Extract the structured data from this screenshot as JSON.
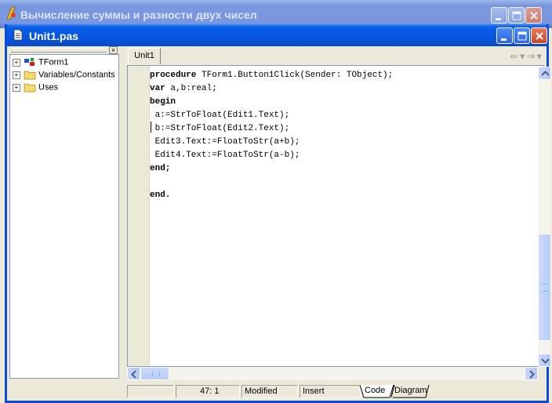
{
  "app": {
    "title": "Вычисление суммы и разности двух чисел"
  },
  "editor_window": {
    "title": "Unit1.pas",
    "tab": "Unit1"
  },
  "code_explorer": {
    "items": [
      {
        "label": "TForm1",
        "icon": "class-icon"
      },
      {
        "label": "Variables/Constants",
        "icon": "folder-icon"
      },
      {
        "label": "Uses",
        "icon": "folder-icon"
      }
    ],
    "close_glyph": "×"
  },
  "code": {
    "lines": [
      {
        "kw": "procedure",
        "rest": " TForm1.Button1Click(Sender: TObject);"
      },
      {
        "kw": "var",
        "rest": " a,b:real;"
      },
      {
        "kw": "begin",
        "rest": ""
      },
      {
        "kw": "",
        "rest": " a:=StrToFloat(Edit1.Text);"
      },
      {
        "kw": "",
        "rest": " b:=StrToFloat(Edit2.Text);"
      },
      {
        "kw": "",
        "rest": " Edit3.Text:=FloatToStr(a+b);"
      },
      {
        "kw": "",
        "rest": " Edit4.Text:=FloatToStr(a-b);"
      },
      {
        "kw": "end;",
        "rest": ""
      },
      {
        "kw": "",
        "rest": ""
      },
      {
        "kw": "end.",
        "rest": ""
      }
    ]
  },
  "nav": {
    "back_glyph": "⇐",
    "fwd_glyph": "⇒",
    "dropdown_glyph": "▾"
  },
  "status_bar": {
    "position": "47:   1",
    "modified": "Modified",
    "mode": "Insert",
    "tab_code": "Code",
    "tab_diagram": "Diagram"
  },
  "colors": {
    "active_title": "#0853DB",
    "inactive_title": "#7A96DF",
    "window_face": "#ECE9D8"
  }
}
